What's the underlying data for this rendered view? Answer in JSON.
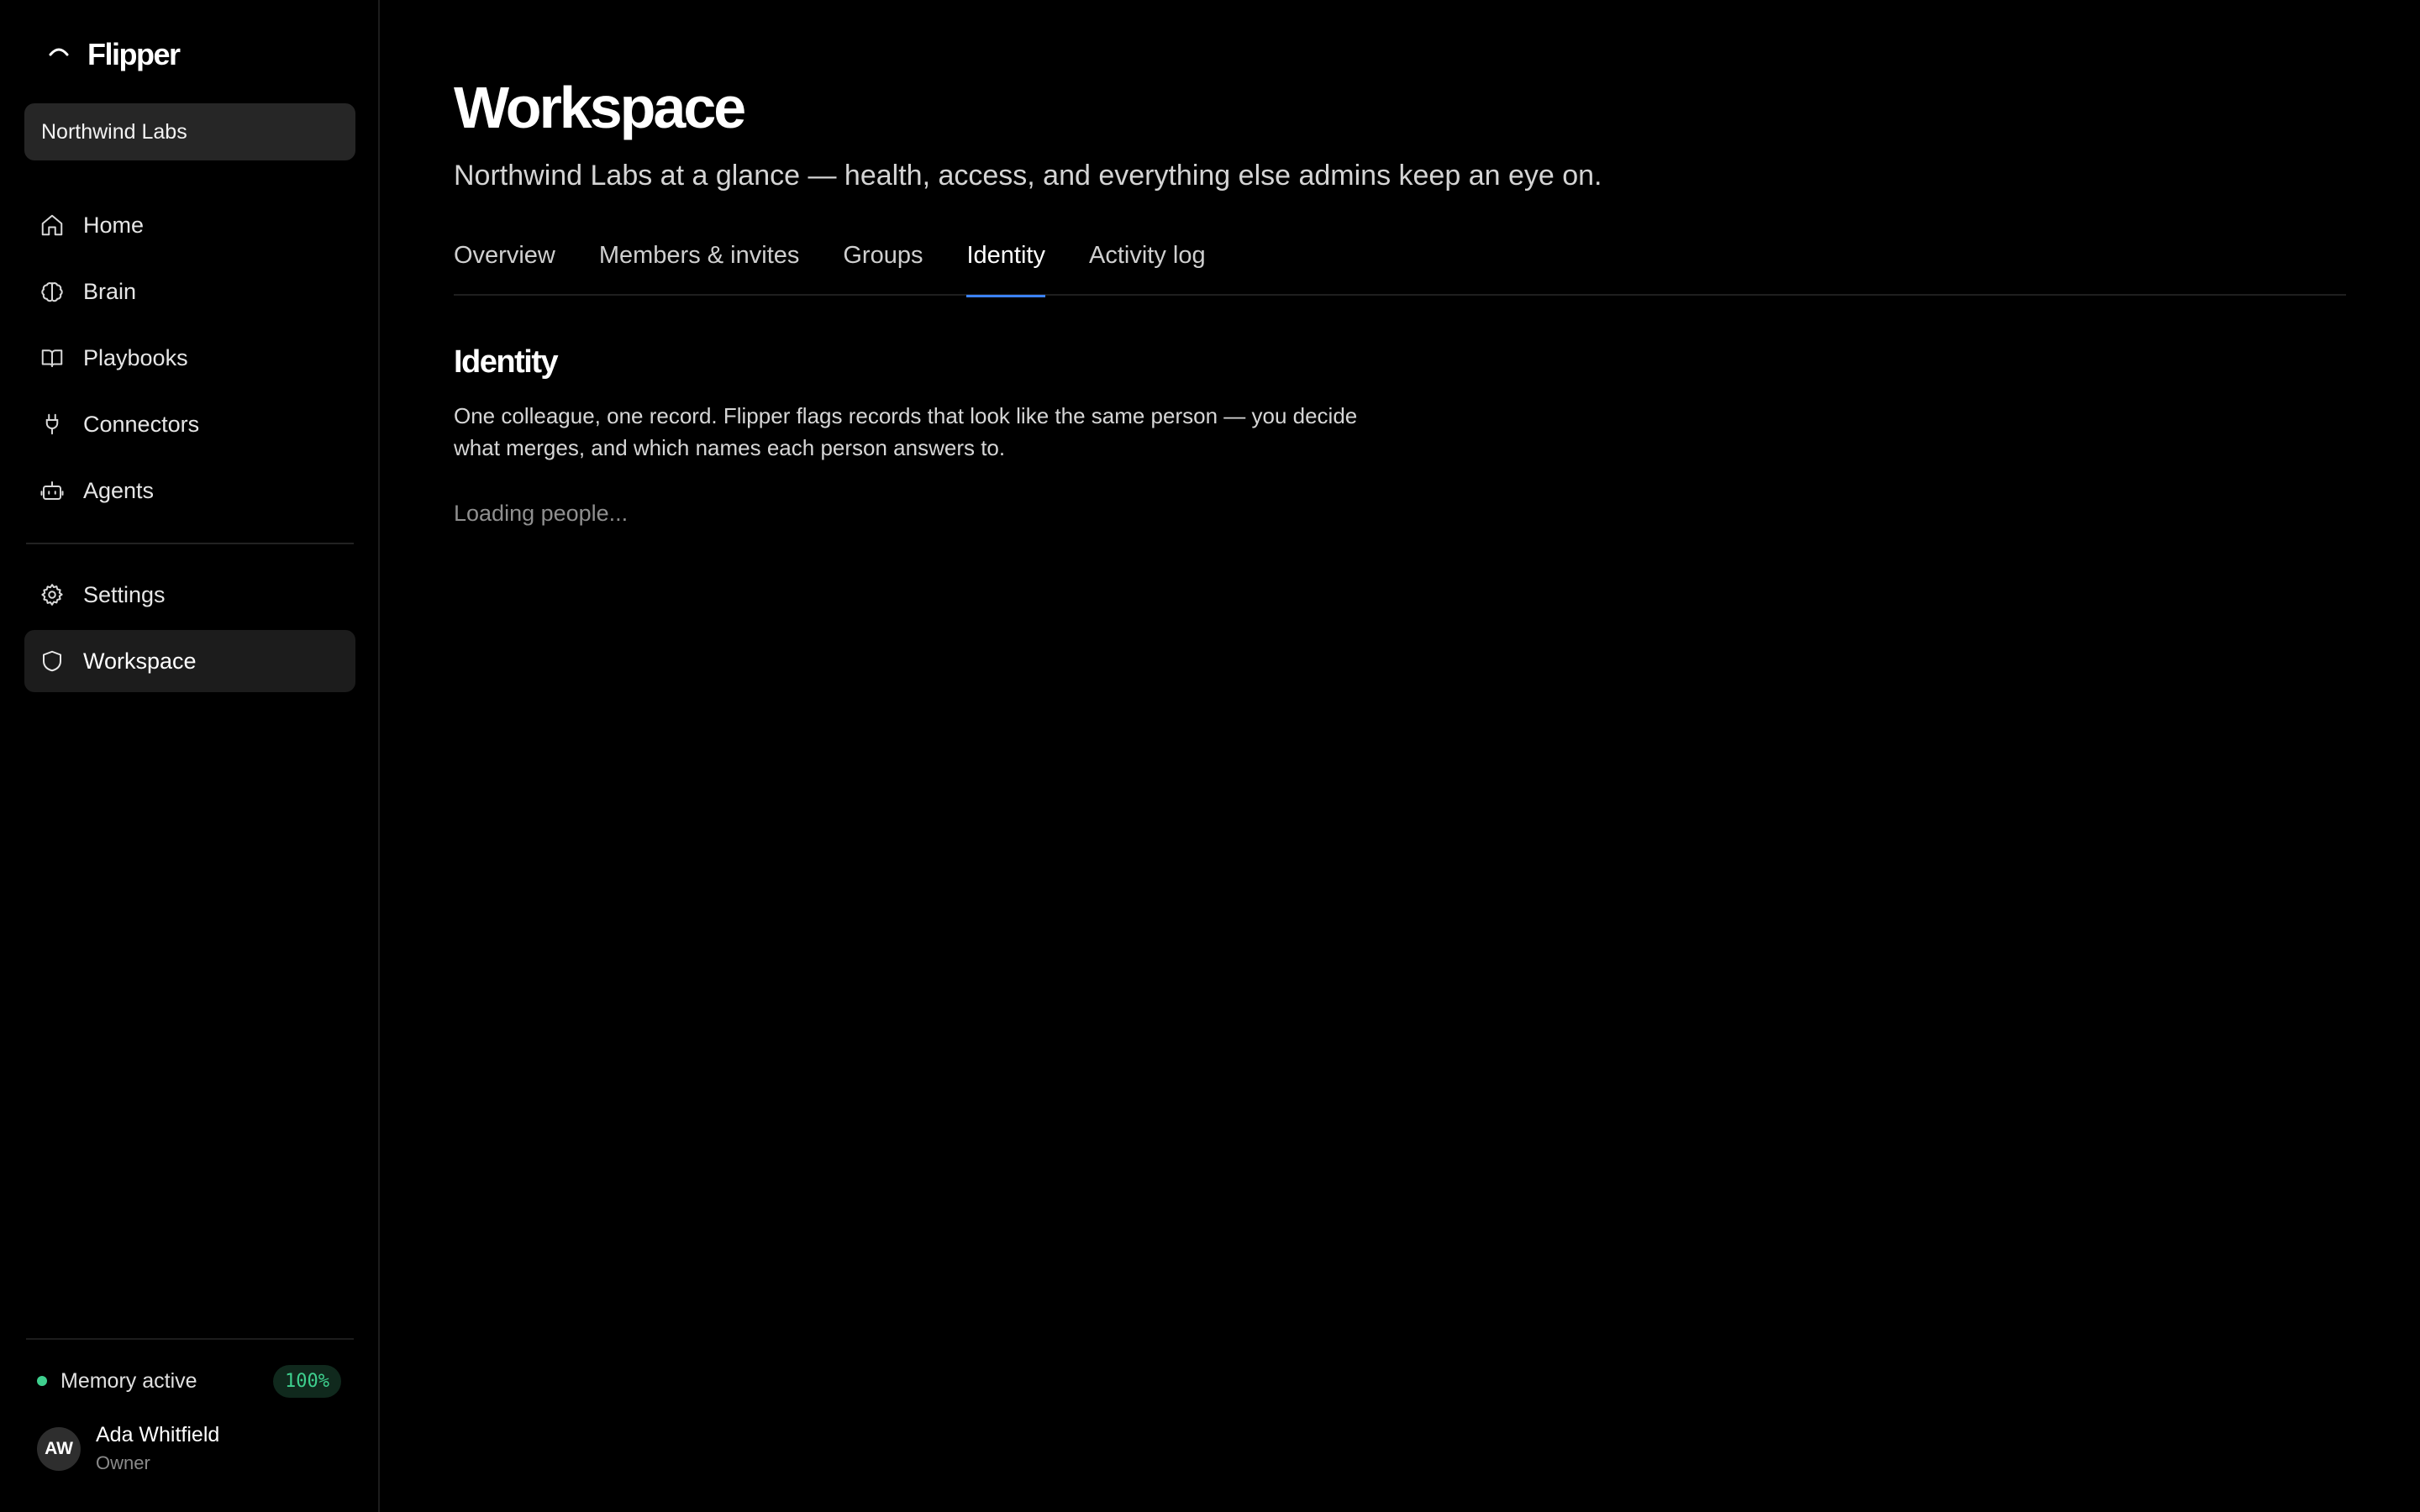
{
  "app": {
    "name": "Flipper"
  },
  "org": {
    "name": "Northwind Labs"
  },
  "sidebar": {
    "nav_top": [
      {
        "label": "Home",
        "icon": "home-icon"
      },
      {
        "label": "Brain",
        "icon": "brain-icon"
      },
      {
        "label": "Playbooks",
        "icon": "book-icon"
      },
      {
        "label": "Connectors",
        "icon": "plug-icon"
      },
      {
        "label": "Agents",
        "icon": "robot-icon"
      }
    ],
    "nav_bottom": [
      {
        "label": "Settings",
        "icon": "gear-icon"
      },
      {
        "label": "Workspace",
        "icon": "shield-icon",
        "active": true
      }
    ],
    "memory": {
      "label": "Memory active",
      "percent": "100%",
      "status_color": "#3ecf8e"
    },
    "user": {
      "initials": "AW",
      "name": "Ada Whitfield",
      "role": "Owner"
    }
  },
  "main": {
    "title": "Workspace",
    "subtitle": "Northwind Labs at a glance — health, access, and everything else admins keep an eye on.",
    "tabs": [
      {
        "label": "Overview"
      },
      {
        "label": "Members & invites"
      },
      {
        "label": "Groups"
      },
      {
        "label": "Identity",
        "active": true
      },
      {
        "label": "Activity log"
      }
    ],
    "active_tab_accent": "#3b82f6",
    "section": {
      "title": "Identity",
      "description": "One colleague, one record. Flipper flags records that look like the same person — you decide what merges, and which names each person answers to.",
      "loading_text": "Loading people..."
    }
  }
}
